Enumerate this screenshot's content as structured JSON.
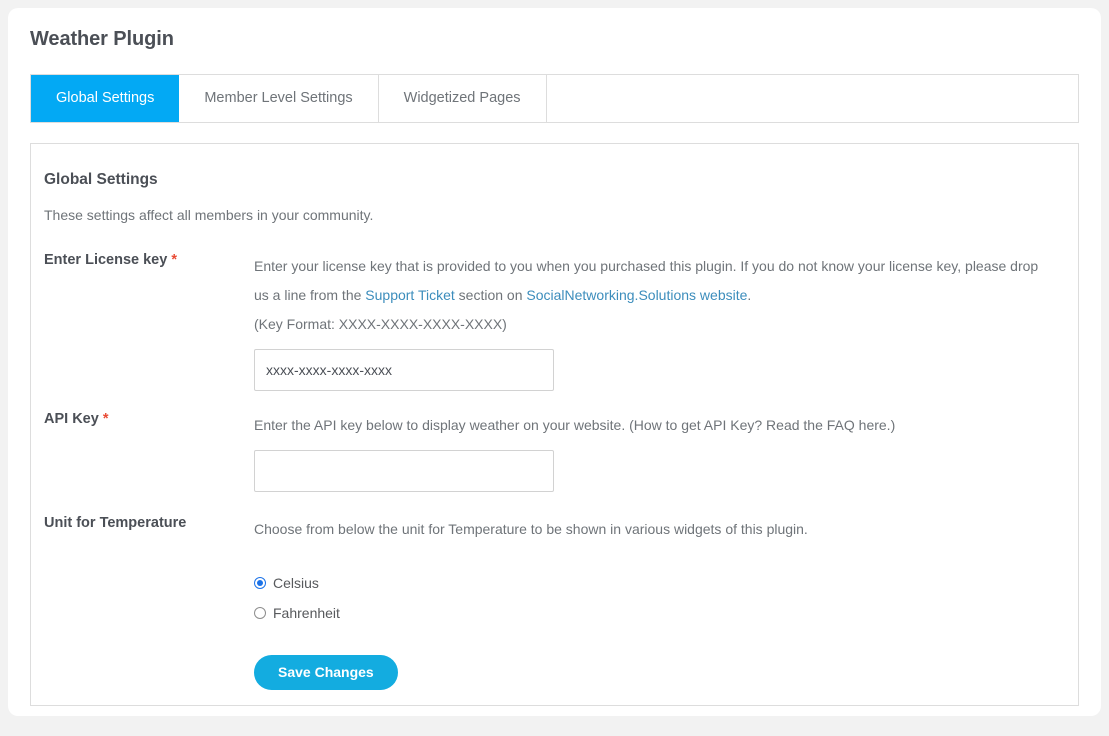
{
  "page": {
    "title": "Weather Plugin"
  },
  "tabs": [
    {
      "label": "Global Settings",
      "active": true
    },
    {
      "label": "Member Level Settings",
      "active": false
    },
    {
      "label": "Widgetized Pages",
      "active": false
    }
  ],
  "panel": {
    "title": "Global Settings",
    "subtitle": "These settings affect all members in your community."
  },
  "fields": {
    "license": {
      "label": "Enter License key",
      "required_marker": "*",
      "desc_part1": "Enter your license key that is provided to you when you purchased this plugin. If you do not know your license key, please drop us a line from the ",
      "link1": "Support Ticket",
      "desc_part2": " section on ",
      "link2": "SocialNetworking.Solutions website",
      "desc_part3": ".",
      "key_format": "(Key Format: XXXX-XXXX-XXXX-XXXX)",
      "input_value": "xxxx-xxxx-xxxx-xxxx",
      "input_placeholder": ""
    },
    "api_key": {
      "label": "API Key",
      "required_marker": "*",
      "desc": "Enter the API key below to display weather on your website. (How to get API Key? Read the FAQ here.)",
      "input_value": "",
      "input_placeholder": ""
    },
    "unit": {
      "label": "Unit for Temperature",
      "desc": "Choose from below the unit for Temperature to be shown in various widgets of this plugin.",
      "options": [
        {
          "label": "Celsius",
          "checked": true
        },
        {
          "label": "Fahrenheit",
          "checked": false
        }
      ]
    }
  },
  "actions": {
    "save_label": "Save Changes"
  },
  "colors": {
    "accent_blue": "#03a9f4",
    "button_blue": "#13ace0",
    "link_blue": "#3c8dbc",
    "required_red": "#e94b35",
    "radio_blue": "#1b72e8"
  }
}
